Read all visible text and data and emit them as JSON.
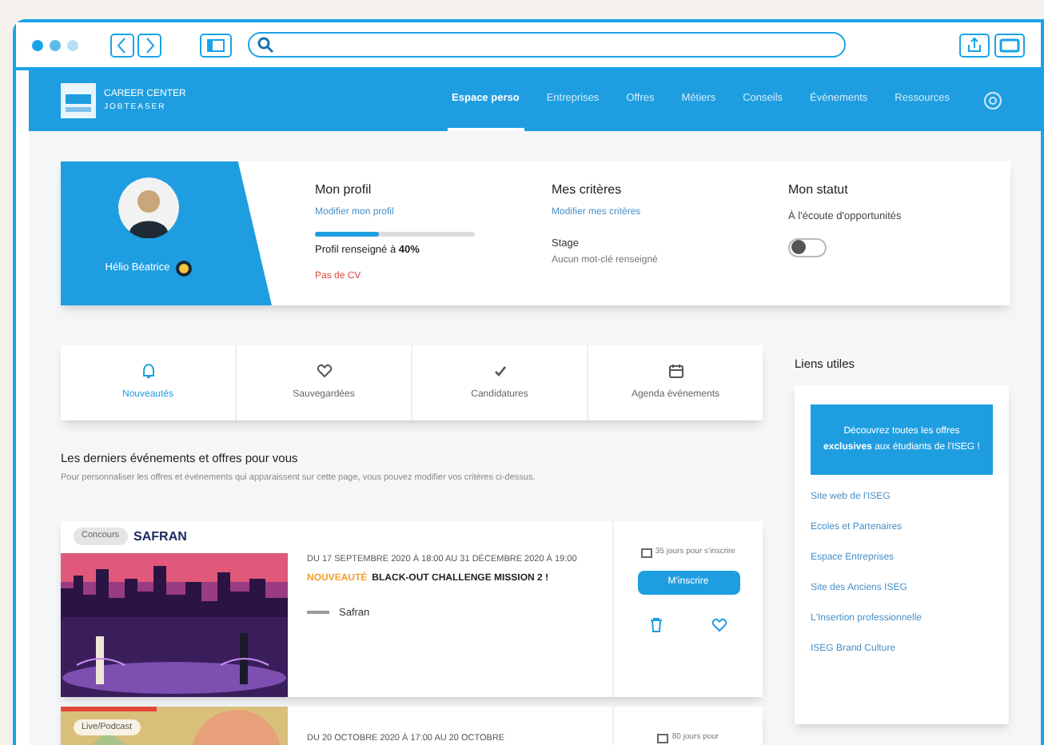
{
  "nav": {
    "logo_lines": [
      "CAREER CENTER",
      "JOBTEASER"
    ],
    "items": [
      {
        "label": "Espace perso",
        "selected": true
      },
      {
        "label": "Entreprises",
        "selected": false
      },
      {
        "label": "Offres",
        "selected": false
      },
      {
        "label": "Métiers",
        "selected": false
      },
      {
        "label": "Conseils",
        "selected": false
      },
      {
        "label": "Événements",
        "selected": false
      },
      {
        "label": "Ressources",
        "selected": false
      }
    ]
  },
  "profile": {
    "name": "Hélio Béatrice",
    "columns": [
      {
        "kind": "profile",
        "title": "Mon profil",
        "link": "Modifier mon profil",
        "level": 0.4,
        "progress_text": "Profil renseigné à **40%**",
        "warning": "Pas de CV"
      },
      {
        "kind": "criteria",
        "title": "Mes critères",
        "link": "Modifier mes critères",
        "value": "Stage",
        "note": "Aucun mot-clé renseigné"
      },
      {
        "kind": "status",
        "title": "Mon statut",
        "label": "À l'écoute d'opportunités",
        "on": false
      }
    ]
  },
  "tabs": [
    {
      "label": "Nouveautés",
      "selected": true
    },
    {
      "label": "Sauvegardées",
      "selected": false
    },
    {
      "label": "Candidatures",
      "selected": false
    },
    {
      "label": "Agenda événements",
      "selected": false
    }
  ],
  "feed": {
    "title": "Les derniers événements et offres pour vous",
    "subtitle": "Pour personnaliser les offres et événements qui apparaissent sur cette page, vous pouvez modifier vos critères ci-dessus.",
    "events": [
      {
        "badge": "Concours",
        "logo": "SAFRAN",
        "date": "DU 17 SEPTEMBRE 2020 À 18:00 AU 31 DÉCEMBRE 2020 À 19:00",
        "tag": "NOUVEAUTÉ",
        "title": "BLACK-OUT CHALLENGE MISSION 2 !",
        "company": "Safran",
        "deadline": "35 jours pour s'inscrire",
        "button": "M'inscrire"
      },
      {
        "badge": "Live/Podcast",
        "date": "DU 20 OCTOBRE 2020 À 17:00 AU 20 OCTOBRE",
        "deadline": "80 jours pour"
      }
    ]
  },
  "sidebar": {
    "title": "Liens utiles",
    "promo": "Découvrez toutes les offres **exclusives** aux étudiants de l'ISEG !",
    "links": [
      "Site web de l'ISEG",
      "Ecoles et Partenaires",
      "Espace Entreprises",
      "Site des Anciens ISEG",
      "L'Insertion professionnelle",
      "ISEG Brand Culture"
    ]
  }
}
